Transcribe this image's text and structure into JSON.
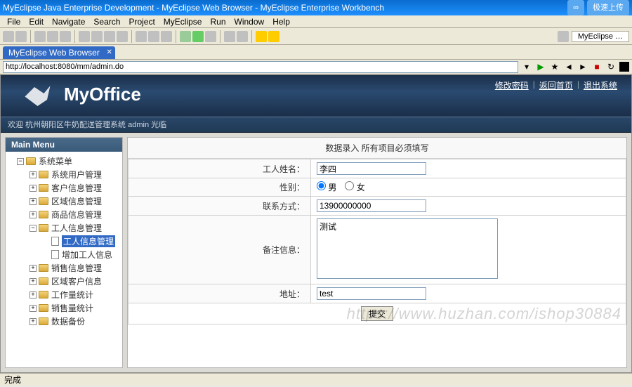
{
  "window": {
    "title": "MyEclipse Java Enterprise Development - MyEclipse Web Browser - MyEclipse Enterprise Workbench",
    "upload_btn": "极速上传"
  },
  "menu": [
    "File",
    "Edit",
    "Navigate",
    "Search",
    "Project",
    "MyEclipse",
    "Run",
    "Window",
    "Help"
  ],
  "editor_tab": "MyEclipse …",
  "browser_tab": "MyEclipse Web Browser",
  "url": "http://localhost:8080/mm/admin.do",
  "brand": "MyOffice",
  "header_links": [
    "修改密码",
    "返回首页",
    "退出系统"
  ],
  "welcome": "欢迎 杭州朝阳区牛奶配送管理系统 admin 光临",
  "sidebar": {
    "title": "Main Menu",
    "root": "系统菜单",
    "items": [
      {
        "label": "系统用户管理",
        "level": 2,
        "exp": "+"
      },
      {
        "label": "客户信息管理",
        "level": 2,
        "exp": "+"
      },
      {
        "label": "区域信息管理",
        "level": 2,
        "exp": "+"
      },
      {
        "label": "商品信息管理",
        "level": 2,
        "exp": "+"
      },
      {
        "label": "工人信息管理",
        "level": 2,
        "exp": "-"
      },
      {
        "label": "工人信息管理",
        "level": 3,
        "leaf": true,
        "selected": true
      },
      {
        "label": "增加工人信息",
        "level": 3,
        "leaf": true
      },
      {
        "label": "销售信息管理",
        "level": 2,
        "exp": "+"
      },
      {
        "label": "区域客户信息",
        "level": 2,
        "exp": "+"
      },
      {
        "label": "工作量统计",
        "level": 2,
        "exp": "+"
      },
      {
        "label": "销售量统计",
        "level": 2,
        "exp": "+"
      },
      {
        "label": "数据备份",
        "level": 2,
        "exp": "+"
      }
    ]
  },
  "form": {
    "title": "数据录入 所有项目必须填写",
    "name_label": "工人姓名：",
    "name_value": "李四",
    "gender_label": "性别：",
    "gender_male": "男",
    "gender_female": "女",
    "phone_label": "联系方式：",
    "phone_value": "13900000000",
    "remark_label": "备注信息：",
    "remark_value": "测试",
    "addr_label": "地址：",
    "addr_value": "test",
    "submit": "提交"
  },
  "status": "完成",
  "watermark": "https://www.huzhan.com/ishop30884"
}
